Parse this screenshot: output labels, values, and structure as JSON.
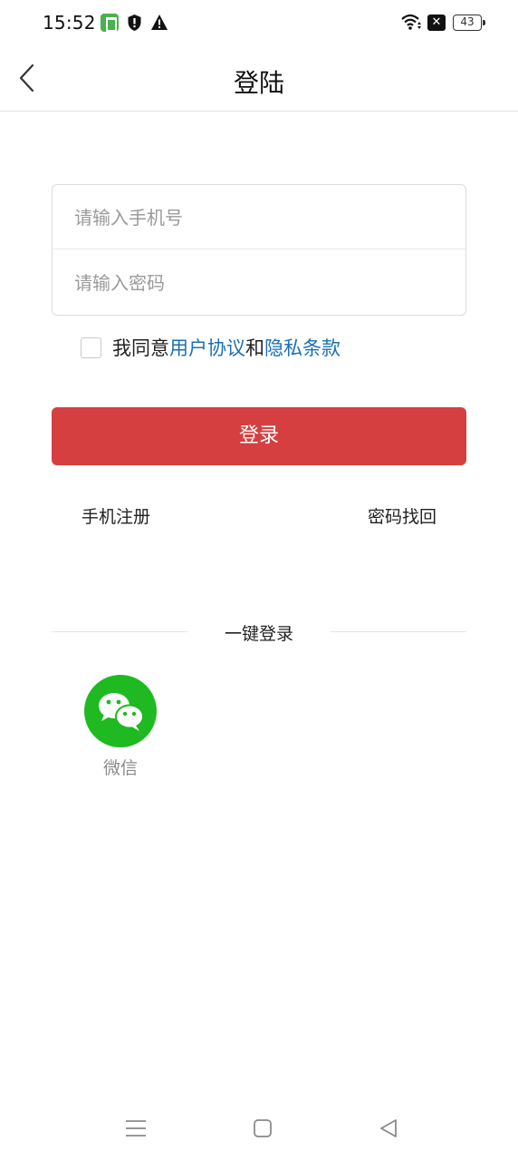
{
  "status_bar": {
    "time": "15:52",
    "battery": "43",
    "icons": [
      "app-notification-icon",
      "shield-icon",
      "warning-icon",
      "wifi-icon",
      "sim-off-icon",
      "battery-icon"
    ]
  },
  "header": {
    "title": "登陆",
    "back_icon": "chevron-left-icon"
  },
  "form": {
    "phone_placeholder": "请输入手机号",
    "phone_value": "",
    "password_placeholder": "请输入密码",
    "password_value": ""
  },
  "agreement": {
    "prefix": "我同意",
    "user_agreement": "用户协议",
    "conjunction": "和",
    "privacy_policy": "隐私条款",
    "checked": false
  },
  "login_button": "登录",
  "links": {
    "register": "手机注册",
    "recover_password": "密码找回"
  },
  "one_click": {
    "label": "一键登录",
    "wechat_label": "微信"
  },
  "nav_bar": {
    "icons": [
      "menu-icon",
      "home-icon",
      "back-triangle-icon"
    ]
  },
  "colors": {
    "accent_red": "#d63f3f",
    "link_blue": "#1a6fb8",
    "wechat_green": "#1fb922"
  }
}
